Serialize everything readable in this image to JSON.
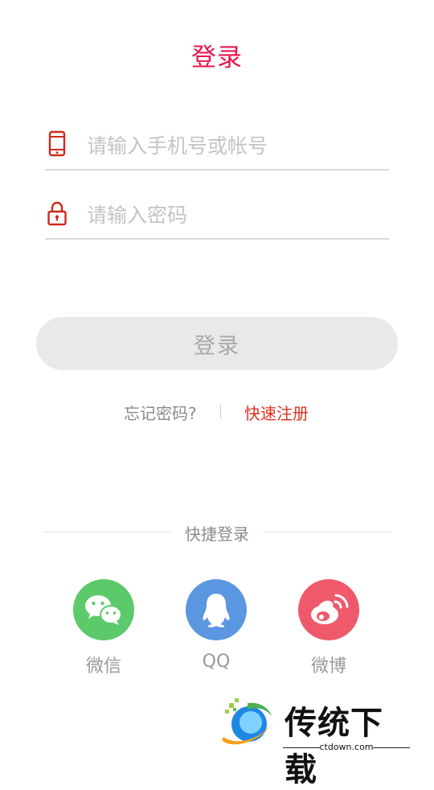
{
  "header": {
    "title": "登录"
  },
  "form": {
    "account_placeholder": "请输入手机号或帐号",
    "password_placeholder": "请输入密码",
    "account_icon": "phone-icon",
    "password_icon": "lock-icon",
    "login_label": "登录"
  },
  "links": {
    "forgot": "忘记密码?",
    "register": "快速注册"
  },
  "quick_login": {
    "title": "快捷登录",
    "items": [
      {
        "label": "微信",
        "icon": "wechat-icon",
        "color": "#5cc96a"
      },
      {
        "label": "QQ",
        "icon": "qq-icon",
        "color": "#5b96e0"
      },
      {
        "label": "微博",
        "icon": "weibo-icon",
        "color": "#ee5a6c"
      }
    ]
  },
  "watermark": {
    "name": "传统下载",
    "domain": "ctdown.com"
  },
  "colors": {
    "accent": "#e8174c",
    "icon_red": "#d1291b",
    "register_red": "#e0311f",
    "button_bg": "#e9e9e9"
  }
}
